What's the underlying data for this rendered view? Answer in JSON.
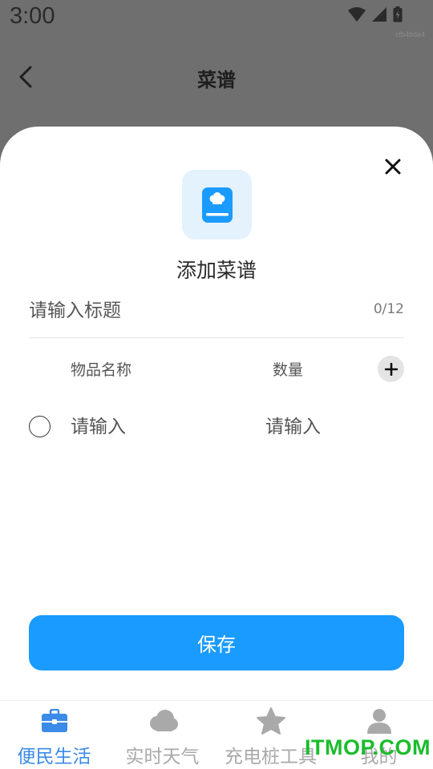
{
  "status_bar": {
    "time": "3:00",
    "corner_tag": "cfb4bde4"
  },
  "nav": {
    "title": "菜谱"
  },
  "sheet": {
    "title": "添加菜谱",
    "title_input": {
      "placeholder": "请输入标题",
      "value": ""
    },
    "counter": "0/12",
    "columns": {
      "name": "物品名称",
      "qty": "数量"
    },
    "item_row": {
      "name_placeholder": "请输入",
      "qty_placeholder": "请输入"
    },
    "save_label": "保存"
  },
  "tabbar": {
    "tabs": [
      {
        "label": "便民生活",
        "icon": "briefcase-icon",
        "active": true
      },
      {
        "label": "实时天气",
        "icon": "cloud-icon",
        "active": false
      },
      {
        "label": "充电桩工具",
        "icon": "star-icon",
        "active": false
      },
      {
        "label": "我的",
        "icon": "user-icon",
        "active": false
      }
    ]
  },
  "watermark": "ITMOP.COM",
  "colors": {
    "accent": "#1a9bff",
    "active_tab": "#3b8be8",
    "inactive_tab": "#a9a9a9",
    "icon_bg": "#e3f2fd"
  }
}
